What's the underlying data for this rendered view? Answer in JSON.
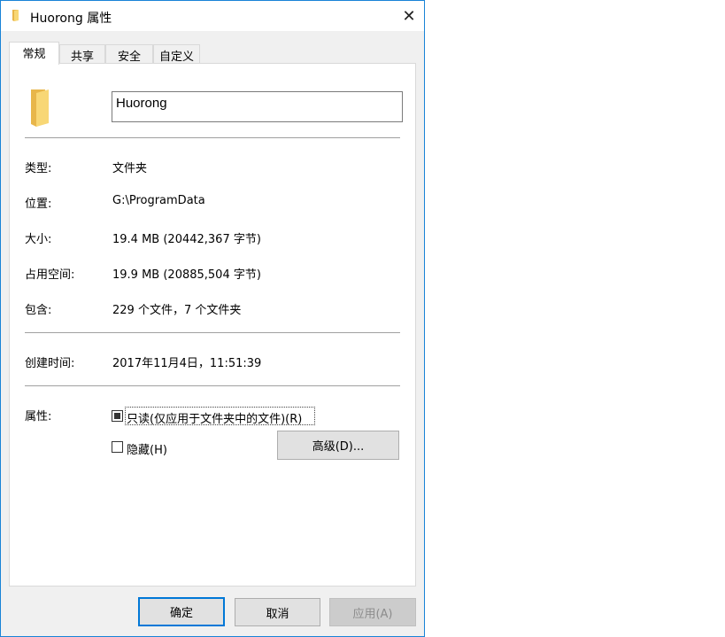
{
  "window": {
    "title": "Huorong 属性",
    "close_label": "✕"
  },
  "tabs": [
    {
      "label": "常规",
      "active": true
    },
    {
      "label": "共享"
    },
    {
      "label": "安全"
    },
    {
      "label": "自定义"
    }
  ],
  "general": {
    "name_value": "Huorong",
    "type_label": "类型:",
    "type_value": "文件夹",
    "location_label": "位置:",
    "location_value": "G:\\ProgramData",
    "size_label": "大小:",
    "size_value": "19.4 MB (20442,367 字节)",
    "disk_size_label": "占用空间:",
    "disk_size_value": "19.9 MB (20885,504 字节)",
    "contains_label": "包含:",
    "contains_value": "229 个文件，7 个文件夹",
    "created_label": "创建时间:",
    "created_value": "2017年11月4日，11:51:39",
    "attributes_label": "属性:",
    "readonly_label": "只读(仅应用于文件夹中的文件)(R)",
    "readonly_state": "indeterminate",
    "hidden_label": "隐藏(H)",
    "hidden_checked": false,
    "advanced_label": "高级(D)..."
  },
  "buttons": {
    "ok": "确定",
    "cancel": "取消",
    "apply": "应用(A)"
  },
  "colors": {
    "accent": "#0078d7",
    "folder": "#f8d775",
    "window_border": "#1883d7"
  },
  "icons": {
    "title": "folder-icon",
    "large": "folder-icon",
    "close": "close-icon"
  }
}
